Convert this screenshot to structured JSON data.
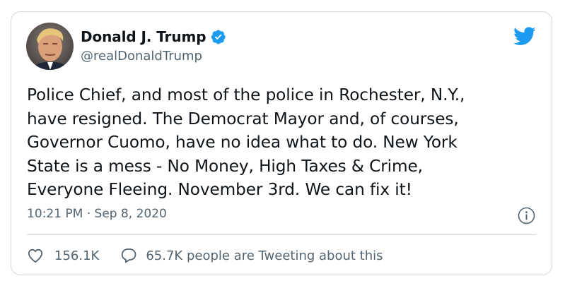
{
  "tweet": {
    "display_name": "Donald J. Trump",
    "handle": "@realDonaldTrump",
    "text": "Police Chief, and most of the police in Rochester, N.Y.,\nhave resigned. The Democrat Mayor and, of courses,\nGovernor Cuomo, have no idea what to do. New York\nState is a mess - No Money, High Taxes & Crime,\nEveryone Fleeing. November 3rd. We can fix it!",
    "timestamp": "10:21 PM · Sep 8, 2020",
    "like_count": "156.1K",
    "tweeting_about": "65.7K people are Tweeting about this"
  },
  "icons": {
    "verified": "verified-badge-icon",
    "brand": "twitter-bird-icon",
    "info": "info-icon",
    "like": "heart-icon",
    "reply": "speech-bubble-icon"
  },
  "colors": {
    "brand_blue": "#1d9bf0",
    "text_primary": "#0f1419",
    "text_secondary": "#536471",
    "border": "#cfd9de"
  }
}
